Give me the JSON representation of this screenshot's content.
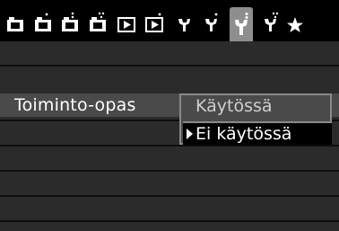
{
  "tabs": [
    {
      "name": "shooting-1",
      "icon": "camera-icon",
      "dots": 0
    },
    {
      "name": "shooting-2",
      "icon": "camera-icon",
      "dots": 1
    },
    {
      "name": "shooting-3",
      "icon": "camera-icon",
      "dots": 2
    },
    {
      "name": "shooting-4",
      "icon": "camera-icon",
      "dots": 3
    },
    {
      "name": "playback-1",
      "icon": "play-icon",
      "dots": 0
    },
    {
      "name": "playback-2",
      "icon": "play-icon",
      "dots": 1
    },
    {
      "name": "setup-1",
      "icon": "wrench-icon",
      "dots": 0
    },
    {
      "name": "setup-2",
      "icon": "wrench-icon",
      "dots": 1
    },
    {
      "name": "setup-3",
      "icon": "wrench-icon",
      "dots": 2,
      "active": true
    },
    {
      "name": "setup-4",
      "icon": "wrench-icon",
      "dots": 3
    },
    {
      "name": "my-menu",
      "icon": "star-icon",
      "dots": 0
    }
  ],
  "menu": {
    "item_label": "Toiminto-opas",
    "item_value": "Käytössä",
    "options": [
      "Käytössä",
      "Ei käytössä"
    ],
    "selected_option": "Ei käytössä"
  },
  "colors": {
    "background": "#2b2b2b",
    "highlight": "#4a4a4a",
    "active_tab": "#8e8e8e",
    "text": "#ffffff"
  }
}
